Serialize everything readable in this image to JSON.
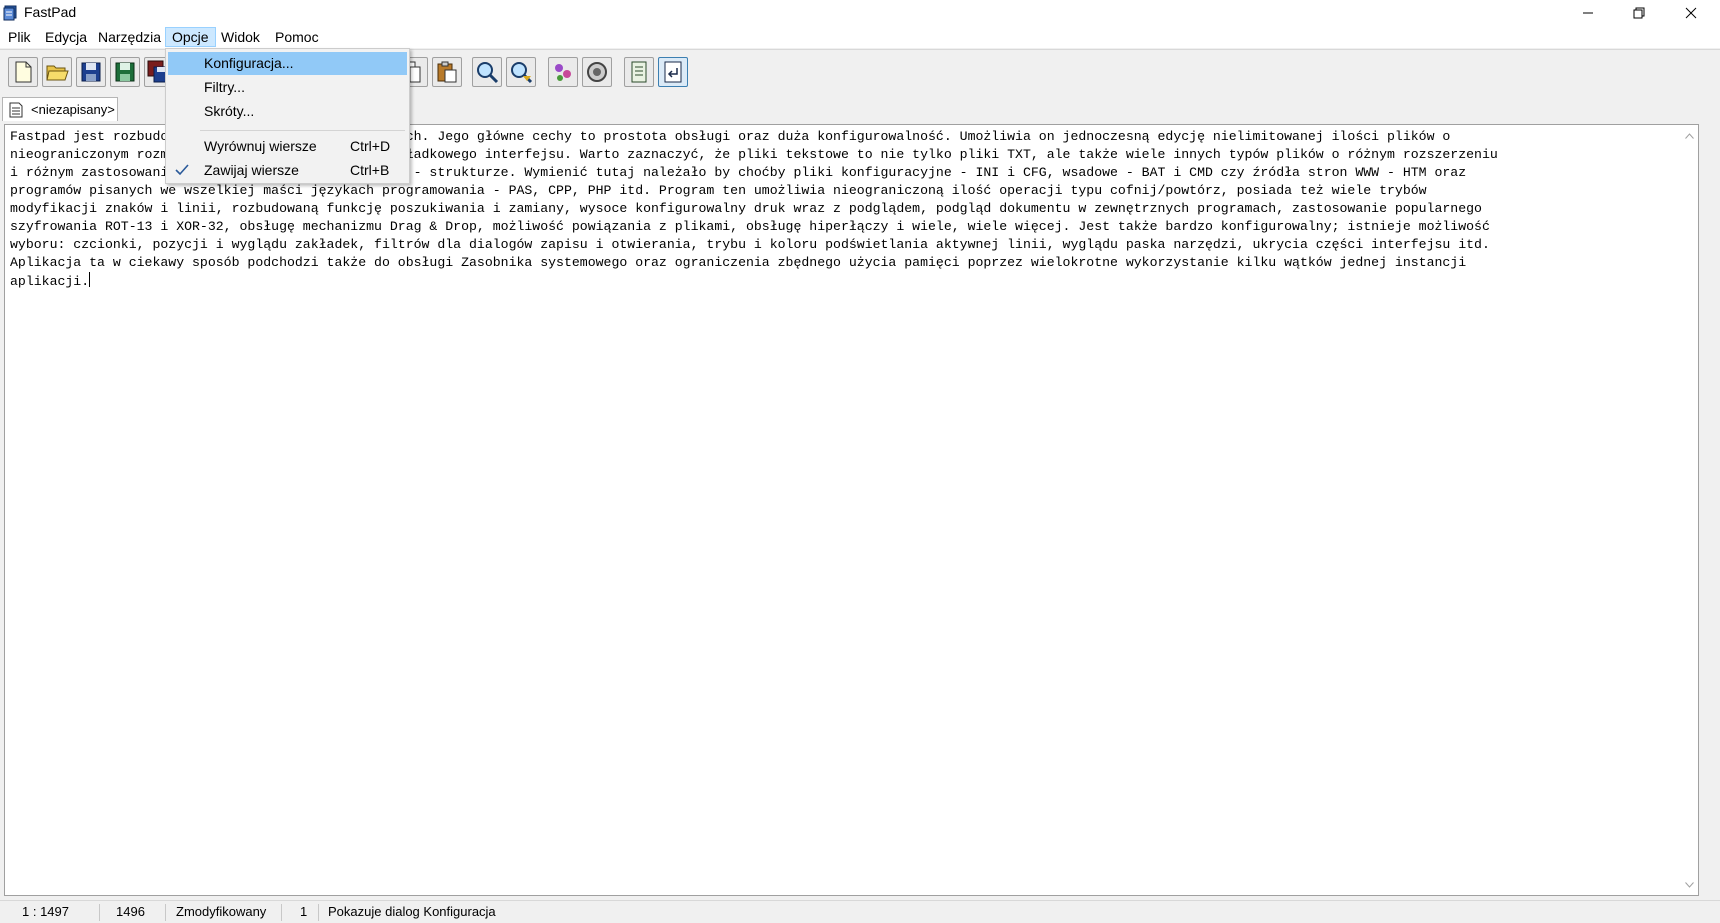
{
  "window": {
    "title": "FastPad"
  },
  "menu": [
    {
      "label": "Plik"
    },
    {
      "label": "Edycja"
    },
    {
      "label": "Narzędzia"
    },
    {
      "label": "Opcje"
    },
    {
      "label": "Widok"
    },
    {
      "label": "Pomoc"
    }
  ],
  "dropdown": {
    "items": [
      {
        "label": "Konfiguracja..."
      },
      {
        "label": "Filtry..."
      },
      {
        "label": "Skróty..."
      },
      {
        "label": "Wyrównuj wiersze",
        "shortcut": "Ctrl+D"
      },
      {
        "label": "Zawijaj wiersze",
        "shortcut": "Ctrl+B",
        "checked": true
      }
    ]
  },
  "tab": {
    "label": "<niezapisany>"
  },
  "editor": {
    "lines": [
      "Fastpad jest rozbudowanym edytorem plików tekstowych. Jego główne cechy to prostota obsługi oraz duża konfigurowalność. Umożliwia on jednoczesną edycję nielimitowanej ilości plików o",
      "nieograniczonym rozmiarze za pomocą wygodnego, zakładkowego interfejsu. Warto zaznaczyć, że pliki tekstowe to nie tylko pliki TXT, ale także wiele innych typów plików o różnym rozszerzeniu",
      "i różnym zastosowaniu, jednak o podobnej tekstowej - strukturze. Wymienić tutaj należało by choćby pliki konfiguracyjne - INI i CFG, wsadowe - BAT i CMD czy źródła stron WWW - HTM oraz",
      "programów pisanych we wszelkiej maści językach programowania - PAS, CPP, PHP itd. Program ten umożliwia nieograniczoną ilość operacji typu cofnij/powtórz, posiada też wiele trybów",
      "modyfikacji znaków i linii, rozbudowaną funkcję poszukiwania i zamiany, wysoce konfigurowalny druk wraz z podglądem, podgląd dokumentu w zewnętrznych programach, zastosowanie popularnego",
      "szyfrowania ROT-13 i XOR-32, obsługę mechanizmu Drag & Drop, możliwość powiązania z plikami, obsługę hiperłączy i wiele, wiele więcej. Jest także bardzo konfigurowalny; istnieje możliwość",
      "wyboru: czcionki, pozycji i wyglądu zakładek, filtrów dla dialogów zapisu i otwierania, trybu i koloru podświetlania aktywnej linii, wyglądu paska narzędzi, ukrycia części interfejsu itd.",
      "Aplikacja ta w ciekawy sposób podchodzi także do obsługi Zasobnika systemowego oraz ograniczenia zbędnego użycia pamięci poprzez wielokrotne wykorzystanie kilku wątków jednej instancji",
      "aplikacji."
    ]
  },
  "status": {
    "position": "1 : 1497",
    "length": "1496",
    "state": "Zmodyfikowany",
    "tabs": "1",
    "hint": "Pokazuje dialog Konfiguracja"
  },
  "icons": {
    "toolbar": [
      "new-file-icon",
      "open-folder-icon",
      "save-icon",
      "save-as-icon",
      "save-all-icon",
      "copy-icon",
      "paste-icon",
      "find-icon",
      "replace-icon",
      "tools-icon",
      "settings-icon",
      "document-icon",
      "word-wrap-icon"
    ]
  }
}
